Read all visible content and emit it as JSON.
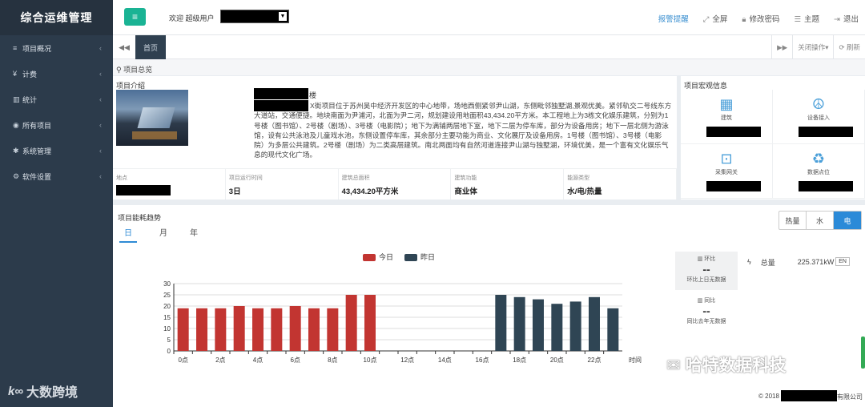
{
  "app": {
    "title": "综合运维管理"
  },
  "sidebar": {
    "items": [
      {
        "icon": "≡",
        "label": "项目概况"
      },
      {
        "icon": "¥",
        "label": "计费"
      },
      {
        "icon": "▥",
        "label": "统计"
      },
      {
        "icon": "◉",
        "label": "所有项目"
      },
      {
        "icon": "✱",
        "label": "系统管理"
      },
      {
        "icon": "⚙",
        "label": "软件设置"
      }
    ]
  },
  "watermark": {
    "left": "大数跨境",
    "left_logo": "k∞",
    "right": "哈特数据科技"
  },
  "topbar": {
    "welcome": "欢迎 超级用户",
    "alarm": "报警提醒",
    "fullscreen": "全屏",
    "change_password": "修改密码",
    "theme": "主题",
    "logout": "退出"
  },
  "tabbar": {
    "home": "首页",
    "close_ops": "关闭操作",
    "refresh": "刷新"
  },
  "breadcrumb": "项目总览",
  "intro": {
    "title": "项目介绍",
    "name_suffix": "楼",
    "description": "X街项目位于苏州吴中经济开发区的中心地带，场地西侧紧邻尹山湖，东侧毗邻独墅湖,景观优美。紧邻轨交二号线东方大道站，交通便捷。地块南面为尹浦河，北面为尹二河，规划建设用地面积43,434.20平方米。本工程地上为3栋文化娱乐建筑，分别为1号楼（图书馆）、2号楼（剧场）、3号楼（电影院）；地下为满铺两层地下室，地下二层为停车库，部分为设备用房；地下一层北侧为游泳馆，设有公共泳池及儿童戏水池，东侧设置停车库，其余部分主要功能为商业、文化展厅及设备用房。1号楼（图书馆）、3号楼（电影院）为多层公共建筑。2号楼（剧场）为二类高层建筑。南北两面均有自然河道连接尹山湖与独墅湖，环境优美，是一个富有文化娱乐气息的现代文化广场。",
    "stats": [
      {
        "label": "地点",
        "value": ""
      },
      {
        "label": "项目运行时间",
        "value": "3日"
      },
      {
        "label": "建筑总面积",
        "value": "43,434.20平方米"
      },
      {
        "label": "建筑功能",
        "value": "商业体"
      },
      {
        "label": "能源类型",
        "value": "水/电/热量"
      }
    ]
  },
  "macro": {
    "title": "项目宏观信息",
    "cells": [
      {
        "icon": "building-icon",
        "glyph": "▦",
        "label": "建筑"
      },
      {
        "icon": "device-icon",
        "glyph": "☮",
        "label": "设备接入"
      },
      {
        "icon": "gateway-icon",
        "glyph": "⊡",
        "label": "采集网关"
      },
      {
        "icon": "recycle-icon",
        "glyph": "♻",
        "label": "数据点位"
      }
    ]
  },
  "energy": {
    "title": "项目能耗趋势",
    "period_tabs": [
      "日",
      "月",
      "年"
    ],
    "type_buttons": [
      "热量",
      "水",
      "电"
    ],
    "active_type": "电",
    "mom_label": "环比",
    "mom_value": "--",
    "mom_note": "环比上日无数据",
    "yoy_label": "同比",
    "yoy_value": "--",
    "yoy_note": "同比去年无数据",
    "total_label": "总量",
    "total_value": "225.371kW",
    "total_unit": "EN"
  },
  "chart_data": {
    "type": "bar",
    "categories": [
      "0点",
      "1点",
      "2点",
      "3点",
      "4点",
      "5点",
      "6点",
      "7点",
      "8点",
      "9点",
      "10点",
      "11点",
      "12点",
      "13点",
      "14点",
      "15点",
      "16点",
      "17点",
      "18点",
      "19点",
      "20点",
      "21点",
      "22点",
      "23点"
    ],
    "tick_labels": [
      "0点",
      "2点",
      "4点",
      "6点",
      "8点",
      "10点",
      "12点",
      "14点",
      "16点",
      "18点",
      "20点",
      "22点"
    ],
    "series": [
      {
        "name": "今日",
        "color": "#c23531",
        "values": [
          19,
          19,
          19,
          20,
          19,
          19,
          20,
          19,
          19,
          25,
          25,
          null,
          null,
          null,
          null,
          null,
          null,
          null,
          null,
          null,
          null,
          null,
          null,
          null
        ]
      },
      {
        "name": "昨日",
        "color": "#2f4554",
        "values": [
          null,
          null,
          null,
          null,
          null,
          null,
          null,
          null,
          null,
          null,
          null,
          null,
          null,
          null,
          null,
          null,
          null,
          25,
          24,
          23,
          21,
          22,
          24,
          19
        ]
      }
    ],
    "xlabel": "时间",
    "ylabel": "",
    "ylim": [
      0,
      30
    ],
    "yticks": [
      0,
      5,
      10,
      15,
      20,
      25,
      30
    ],
    "grid": true,
    "legend": "top-center"
  },
  "footer": {
    "copyright": "© 2018",
    "company_suffix": "有限公司"
  }
}
